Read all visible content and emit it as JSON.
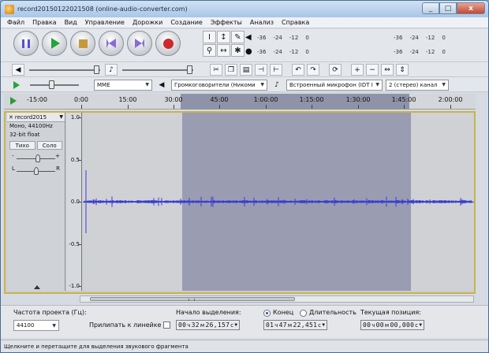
{
  "window": {
    "title": "record20150122021508 (online-audio-converter.com)",
    "close_glyph": "x",
    "min_glyph": "_",
    "max_glyph": "□"
  },
  "menu": [
    "Файл",
    "Правка",
    "Вид",
    "Управление",
    "Дорожки",
    "Создание",
    "Эффекты",
    "Анализ",
    "Справка"
  ],
  "meter": {
    "play_scale": [
      "-36",
      "-24",
      "-12",
      "0"
    ],
    "record_scale": [
      "-36",
      "-24",
      "-12",
      "0"
    ],
    "play_scale2": [
      "-36",
      "-24",
      "-12",
      "0"
    ],
    "record_scale2": [
      "-36",
      "-24",
      "-12",
      "0"
    ]
  },
  "devices": {
    "host": "MME",
    "output": "Громкоговорители (Никоми",
    "input": "Встроенный микрофон (IDT I",
    "channels": "2 (стерео) канал"
  },
  "timeline": {
    "labels": [
      "-15:00",
      "0:00",
      "15:00",
      "30:00",
      "45:00",
      "1:00:00",
      "1:15:00",
      "1:30:00",
      "1:45:00",
      "2:00:00"
    ]
  },
  "track": {
    "name": "record2015",
    "info_lines": [
      "Моно, 44100Hz",
      "32-bit float"
    ],
    "mute": "Тихо",
    "solo": "Соло",
    "gain_minus": "-",
    "gain_plus": "+",
    "pan_left": "L",
    "pan_right": "R",
    "ruler_labels": [
      "1.0",
      "0.5",
      "0.0",
      "-0.5",
      "-1.0"
    ]
  },
  "selection_bar": {
    "rate_label": "Частота проекта (Гц):",
    "rate_value": "44100",
    "snap_label": "Прилипать к линейке",
    "start_label": "Начало выделения:",
    "end_label": "Конец",
    "length_label": "Длительность",
    "position_label": "Текущая позиция:",
    "start_time": {
      "h": "00",
      "m": "32",
      "s": "26,157"
    },
    "end_time": {
      "h": "01",
      "m": "47",
      "s": "22,451"
    },
    "position_time": {
      "h": "00",
      "m": "00",
      "s": "00,000"
    },
    "unit_h": "ч",
    "unit_m": "м",
    "unit_s": "с"
  },
  "status": "Щелкните и перетащите для выделения звукового фрагмента",
  "colors": {
    "waveform": "#3a3ed0",
    "selection": "#9a9cb2",
    "play": "#25a43a",
    "record": "#cc2a2a"
  }
}
